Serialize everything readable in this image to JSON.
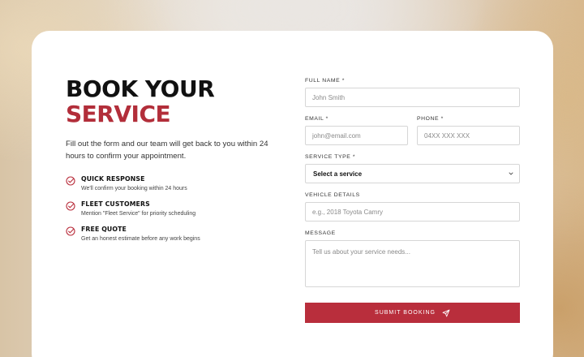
{
  "heading": {
    "line1": "BOOK YOUR",
    "line2": "SERVICE"
  },
  "intro": "Fill out the form and our team will get back to you within 24 hours to confirm your appointment.",
  "features": [
    {
      "icon": "check-circle-icon",
      "title": "QUICK RESPONSE",
      "desc": "We'll confirm your booking within 24 hours"
    },
    {
      "icon": "check-circle-icon",
      "title": "FLEET CUSTOMERS",
      "desc": "Mention \"Fleet Service\" for priority scheduling"
    },
    {
      "icon": "check-circle-icon",
      "title": "FREE QUOTE",
      "desc": "Get an honest estimate before any work begins"
    }
  ],
  "form": {
    "full_name": {
      "label": "FULL NAME *",
      "placeholder": "John Smith"
    },
    "email": {
      "label": "EMAIL *",
      "placeholder": "john@email.com"
    },
    "phone": {
      "label": "PHONE *",
      "placeholder": "04XX XXX XXX"
    },
    "service_type": {
      "label": "SERVICE TYPE *",
      "selected": "Select a service"
    },
    "vehicle": {
      "label": "VEHICLE DETAILS",
      "placeholder": "e.g., 2018 Toyota Camry"
    },
    "message": {
      "label": "MESSAGE",
      "placeholder": "Tell us about your service needs..."
    },
    "submit_label": "SUBMIT BOOKING",
    "submit_icon": "send-icon"
  },
  "colors": {
    "accent": "#b92e3c",
    "heading": "#111111",
    "card": "#ffffff"
  }
}
